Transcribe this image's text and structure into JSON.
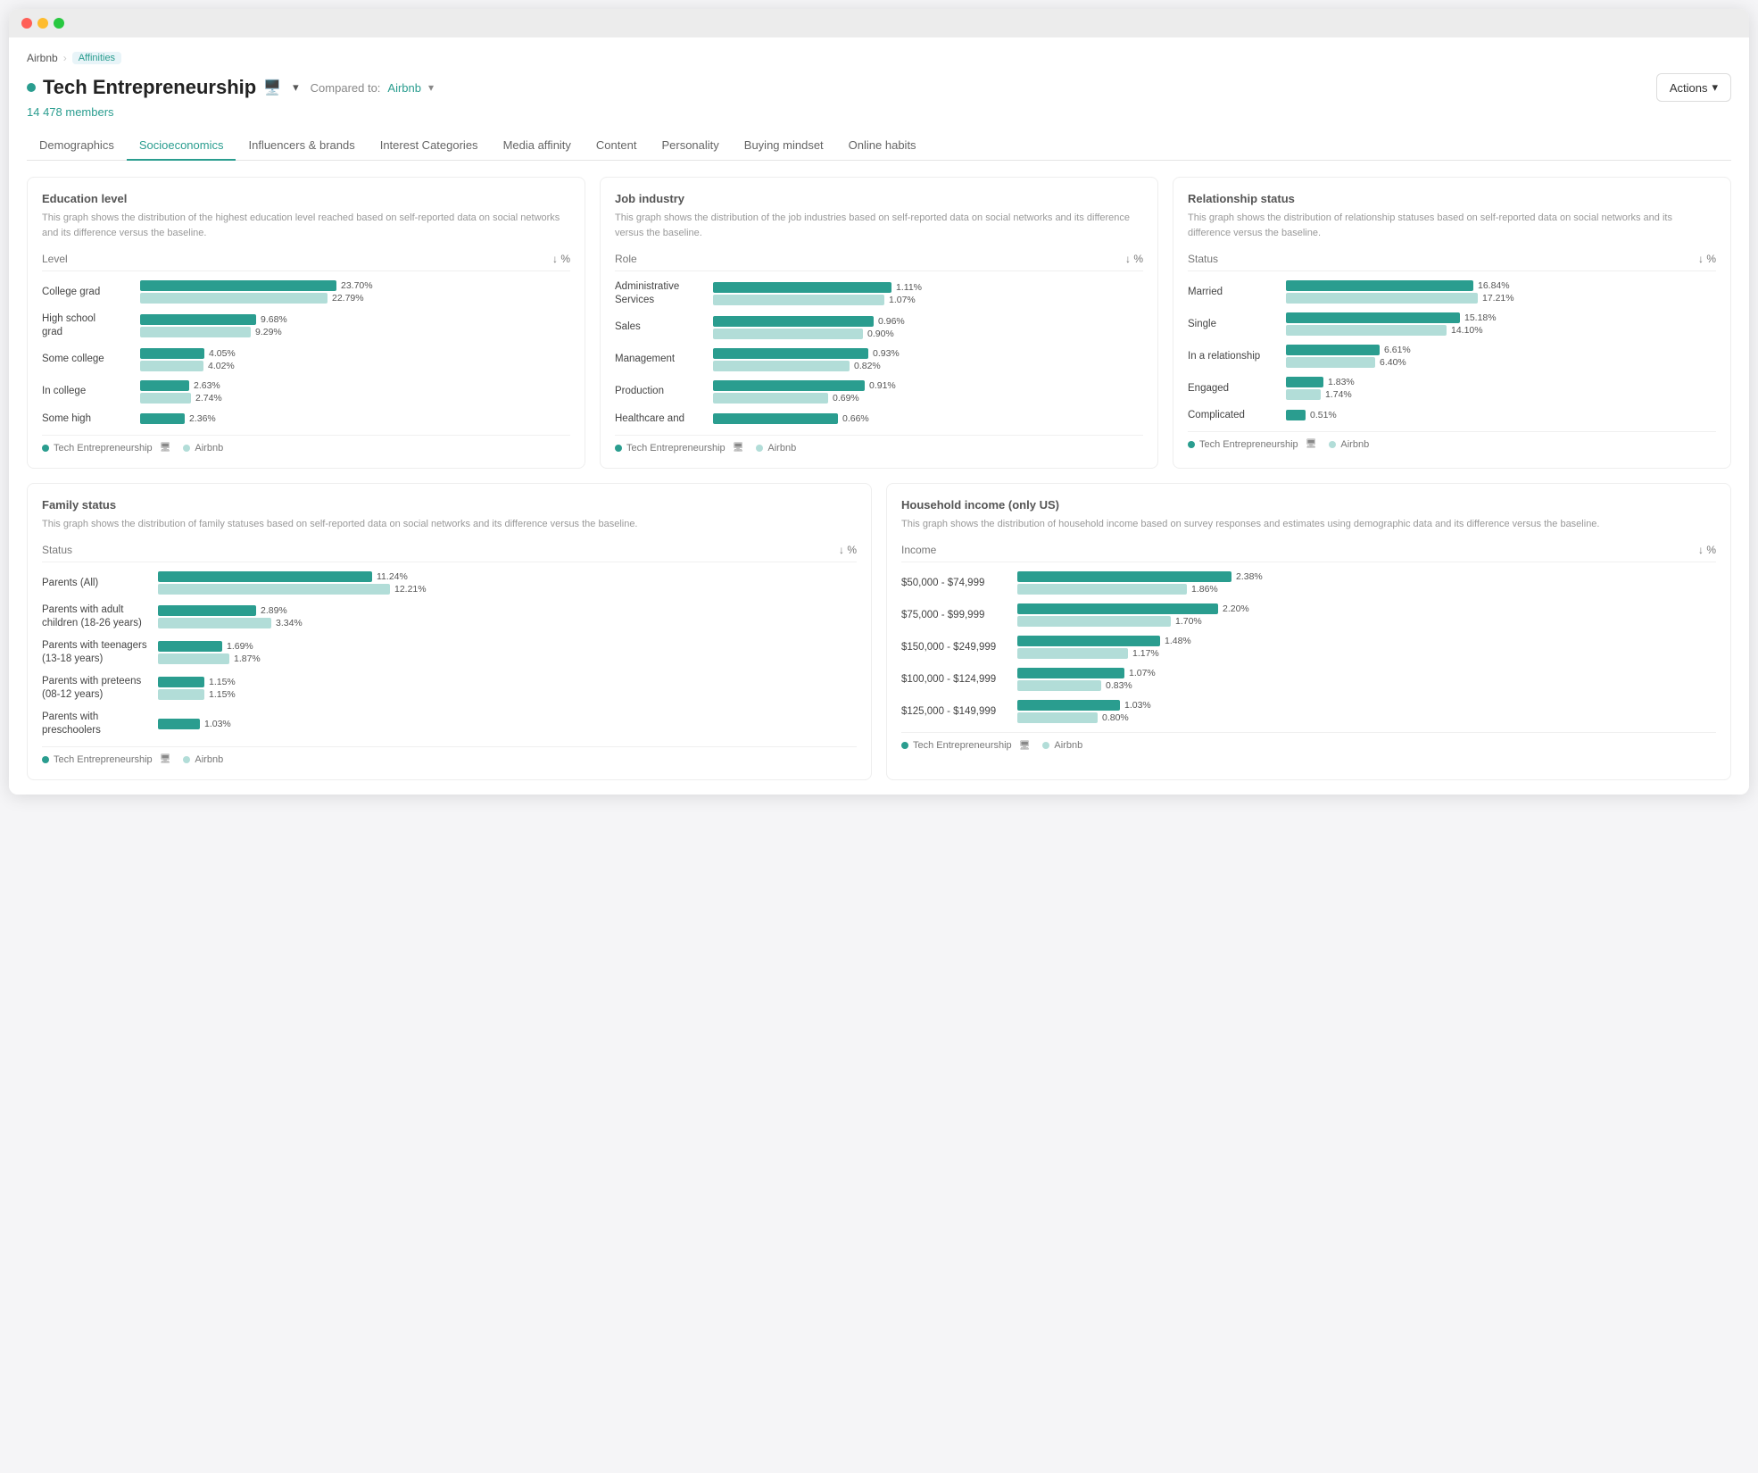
{
  "window": {
    "breadcrumb": {
      "app": "Airbnb",
      "tag": "Affinities"
    },
    "title": "Tech Entrepreneurship",
    "dropdown_label": "▾",
    "compared_to": "Compared to:",
    "compared_link": "Airbnb",
    "actions_label": "Actions",
    "members": "14 478 members"
  },
  "tabs": [
    {
      "label": "Demographics",
      "active": false
    },
    {
      "label": "Socioeconomics",
      "active": true
    },
    {
      "label": "Influencers & brands",
      "active": false
    },
    {
      "label": "Interest Categories",
      "active": false
    },
    {
      "label": "Media affinity",
      "active": false
    },
    {
      "label": "Content",
      "active": false
    },
    {
      "label": "Personality",
      "active": false
    },
    {
      "label": "Buying mindset",
      "active": false
    },
    {
      "label": "Online habits",
      "active": false
    }
  ],
  "education": {
    "title": "Education level",
    "desc": "This graph shows the distribution of the highest education level reached based on self-reported data on social networks and its difference versus the baseline.",
    "col1": "Level",
    "col2": "%",
    "rows": [
      {
        "label": "College grad",
        "val1": "23.70%",
        "bar1": 220,
        "val2": "22.79%",
        "bar2": 210
      },
      {
        "label": "High school grad",
        "val1": "9.68%",
        "bar1": 130,
        "val2": "9.29%",
        "bar2": 124
      },
      {
        "label": "Some college",
        "val1": "4.05%",
        "bar1": 72,
        "val2": "4.02%",
        "bar2": 71
      },
      {
        "label": "In college",
        "val1": "2.63%",
        "bar1": 55,
        "val2": "2.74%",
        "bar2": 57
      },
      {
        "label": "Some high",
        "val1": "2.36%",
        "bar1": 50,
        "val2": "",
        "bar2": 0
      }
    ],
    "legend1": "Tech Entrepreneurship",
    "legend2": "Airbnb"
  },
  "job": {
    "title": "Job industry",
    "desc": "This graph shows the distribution of the job industries based on self-reported data on social networks and its difference versus the baseline.",
    "col1": "Role",
    "col2": "%",
    "rows": [
      {
        "label": "Administrative Services",
        "val1": "1.11%",
        "bar1": 200,
        "val2": "1.07%",
        "bar2": 192
      },
      {
        "label": "Sales",
        "val1": "0.96%",
        "bar1": 180,
        "val2": "0.90%",
        "bar2": 168
      },
      {
        "label": "Management",
        "val1": "0.93%",
        "bar1": 174,
        "val2": "0.82%",
        "bar2": 153
      },
      {
        "label": "Production",
        "val1": "0.91%",
        "bar1": 170,
        "val2": "0.69%",
        "bar2": 129
      },
      {
        "label": "Healthcare and",
        "val1": "0.66%",
        "bar1": 140,
        "val2": "",
        "bar2": 0
      }
    ],
    "legend1": "Tech Entrepreneurship",
    "legend2": "Airbnb"
  },
  "relationship": {
    "title": "Relationship status",
    "desc": "This graph shows the distribution of relationship statuses based on self-reported data on social networks and its difference versus the baseline.",
    "col1": "Status",
    "col2": "%",
    "rows": [
      {
        "label": "Married",
        "val1": "16.84%",
        "bar1": 210,
        "val2": "17.21%",
        "bar2": 215
      },
      {
        "label": "Single",
        "val1": "15.18%",
        "bar1": 195,
        "val2": "14.10%",
        "bar2": 180
      },
      {
        "label": "In a relationship",
        "val1": "6.61%",
        "bar1": 105,
        "val2": "6.40%",
        "bar2": 100
      },
      {
        "label": "Engaged",
        "val1": "1.83%",
        "bar1": 42,
        "val2": "1.74%",
        "bar2": 39
      },
      {
        "label": "Complicated",
        "val1": "0.51%",
        "bar1": 22,
        "val2": "",
        "bar2": 0
      }
    ],
    "legend1": "Tech Entrepreneurship",
    "legend2": "Airbnb"
  },
  "family": {
    "title": "Family status",
    "desc": "This graph shows the distribution of family statuses based on self-reported data on social networks and its difference versus the baseline.",
    "col1": "Status",
    "col2": "%",
    "rows": [
      {
        "label": "Parents (All)",
        "val1": "11.24%",
        "bar1": 240,
        "val2": "12.21%",
        "bar2": 260
      },
      {
        "label": "Parents with adult children (18-26 years)",
        "val1": "2.89%",
        "bar1": 110,
        "val2": "3.34%",
        "bar2": 127
      },
      {
        "label": "Parents with teenagers (13-18 years)",
        "val1": "1.69%",
        "bar1": 72,
        "val2": "1.87%",
        "bar2": 80
      },
      {
        "label": "Parents with preteens (08-12 years)",
        "val1": "1.15%",
        "bar1": 52,
        "val2": "1.15%",
        "bar2": 52
      },
      {
        "label": "Parents with preschoolers",
        "val1": "1.03%",
        "bar1": 47,
        "val2": "",
        "bar2": 0
      }
    ],
    "legend1": "Tech Entrepreneurship",
    "legend2": "Airbnb"
  },
  "income": {
    "title": "Household income (only US)",
    "desc": "This graph shows the distribution of household income based on survey responses and estimates using demographic data and its difference versus the baseline.",
    "col1": "Income",
    "col2": "%",
    "rows": [
      {
        "label": "$50,000 - $74,999",
        "val1": "2.38%",
        "bar1": 240,
        "val2": "1.86%",
        "bar2": 190
      },
      {
        "label": "$75,000 - $99,999",
        "val1": "2.20%",
        "bar1": 225,
        "val2": "1.70%",
        "bar2": 172
      },
      {
        "label": "$150,000 - $249,999",
        "val1": "1.48%",
        "bar1": 160,
        "val2": "1.17%",
        "bar2": 124
      },
      {
        "label": "$100,000 - $124,999",
        "val1": "1.07%",
        "bar1": 120,
        "val2": "0.83%",
        "bar2": 94
      },
      {
        "label": "$125,000 - $149,999",
        "val1": "1.03%",
        "bar1": 115,
        "val2": "0.80%",
        "bar2": 90
      }
    ],
    "legend1": "Tech Entrepreneurship",
    "legend2": "Airbnb"
  }
}
